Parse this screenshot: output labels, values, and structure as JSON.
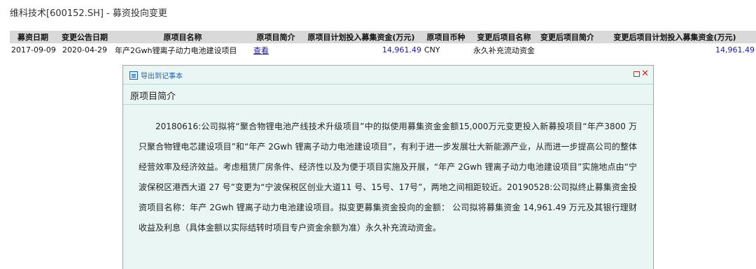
{
  "page_title": "维科技术[600152.SH] - 募资投向变更",
  "table": {
    "headers": [
      "募资日期",
      "变更公告日期",
      "原项目名称",
      "原项目简介",
      "原项目计划投入募集资金(万元)",
      "原项目币种",
      "变更后项目名称",
      "变更后项目简介",
      "变更后项目计划投入募集资金(万元)"
    ],
    "rows": [
      {
        "raise_date": "2017-09-09",
        "announce_date": "2020-04-29",
        "orig_name": "年产2Gwh锂离子动力电池建设项目",
        "orig_intro_link": "查看",
        "orig_amount": "14,961.49",
        "orig_currency": "CNY",
        "new_name": "永久补充流动资金",
        "new_intro": "",
        "new_amount": "14,961.49"
      }
    ]
  },
  "dialog": {
    "export_label": "导出到记事本",
    "heading": "原项目简介",
    "body": "20180616:公司拟将“聚合物锂电池产线技术升级项目”中的拟使用募集资金金额15,000万元变更投入新募投项目“年产3800 万只聚合物锂电芯建设项目”和“年产 2Gwh 锂离子动力电池建设项目”，有利于进一步发展壮大新能源产业，从而进一步提高公司的整体经营效率及经济效益。考虑租赁厂房条件、经济性以及为便于项目实施及开展，“年产 2Gwh 锂离子动力电池建设项目”实施地点由“宁波保税区港西大道 27 号”变更为“宁波保税区创业大道11 号、15号、17号”，两地之间相距较近。20190528:公司拟终止募集资金投资项目名称：年产 2Gwh 锂离子动力电池建设项目。拟变更募集资金投向的金额： 公司拟将募集资金 14,961.49 万元及其银行理财收益及利息（具体金额以实际结转时项目专户资金余额为准）永久补充流动资金。"
  },
  "colors": {
    "link": "#1a1aa6",
    "dialog_bg": "#eaf6f4",
    "header_bg": "#d9d9d9",
    "close": "#dd2222"
  },
  "icons": {
    "export": "notepad-export-icon",
    "maximize": "maximize-icon",
    "close": "close-icon"
  }
}
